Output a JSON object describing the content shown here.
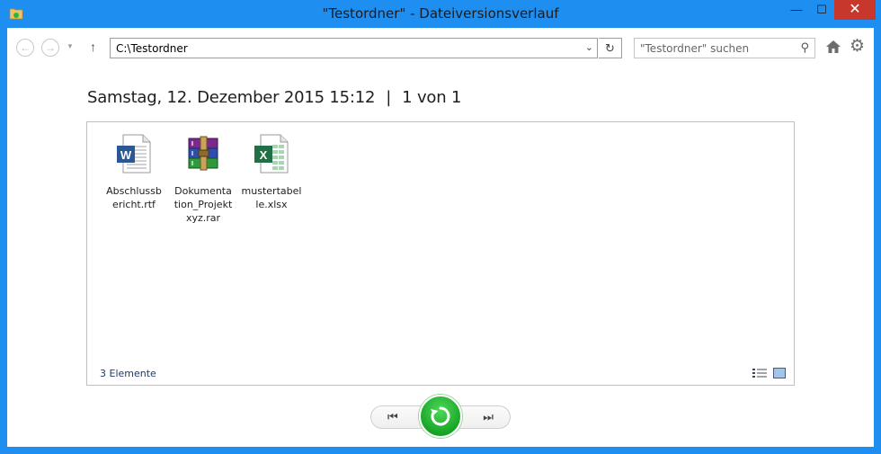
{
  "window": {
    "title": "\"Testordner\" - Dateiversionsverlauf",
    "minimize_glyph": "—",
    "maximize_glyph": "☐",
    "close_glyph": "✕"
  },
  "navbar": {
    "back_glyph": "←",
    "forward_glyph": "→",
    "dropdown_glyph": "▼",
    "up_glyph": "↑",
    "address": "C:\\Testordner",
    "address_dropdown_glyph": "⌄",
    "refresh_glyph": "↻",
    "search_placeholder": "\"Testordner\" suchen",
    "search_glyph": "⚲",
    "gear_glyph": "⚙"
  },
  "version": {
    "date": "Samstag, 12. Dezember 2015 15:12",
    "separator": "|",
    "position": "1 von 1"
  },
  "files": [
    {
      "name": "Abschlussbericht.rtf",
      "icon": "word-document-icon"
    },
    {
      "name": "Dokumentation_Projektxyz.rar",
      "icon": "winrar-archive-icon"
    },
    {
      "name": "mustertabelle.xlsx",
      "icon": "excel-spreadsheet-icon"
    }
  ],
  "status": {
    "item_count": "3 Elemente"
  },
  "controls": {
    "prev_glyph": "⏮",
    "next_glyph": "⏭"
  },
  "colors": {
    "titlebar": "#1e8ff0",
    "close": "#c7372b",
    "restore_green": "#17a526"
  }
}
